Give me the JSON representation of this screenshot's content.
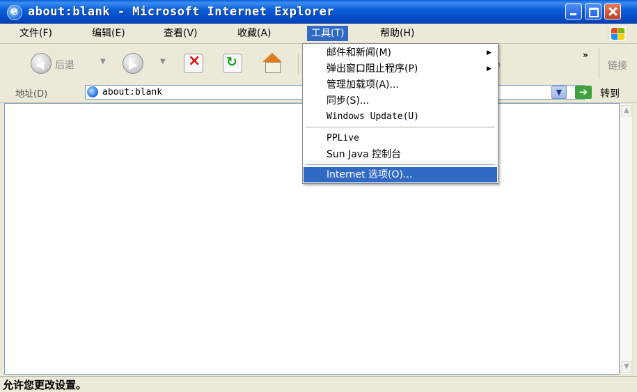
{
  "window": {
    "title": "about:blank - Microsoft Internet Explorer"
  },
  "menubar": {
    "items": [
      "文件(F)",
      "编辑(E)",
      "查看(V)",
      "收藏(A)",
      "工具(T)",
      "帮助(H)"
    ]
  },
  "toolbar": {
    "back_label": "后退",
    "links_label": "链接",
    "overflow": "»"
  },
  "address": {
    "label": "地址(D)",
    "url": "about:blank",
    "go_label": "转到"
  },
  "tools_menu": {
    "items": [
      "邮件和新闻(M)",
      "弹出窗口阻止程序(P)",
      "管理加载项(A)...",
      "同步(S)...",
      "Windows Update(U)",
      "PPLive",
      "Sun Java 控制台",
      "Internet 选项(O)..."
    ]
  },
  "status": {
    "text": "允许您更改设置。"
  },
  "colors": {
    "titlebar": "#0a5fd8",
    "selection": "#316ac5",
    "chrome": "#ece9d8"
  }
}
